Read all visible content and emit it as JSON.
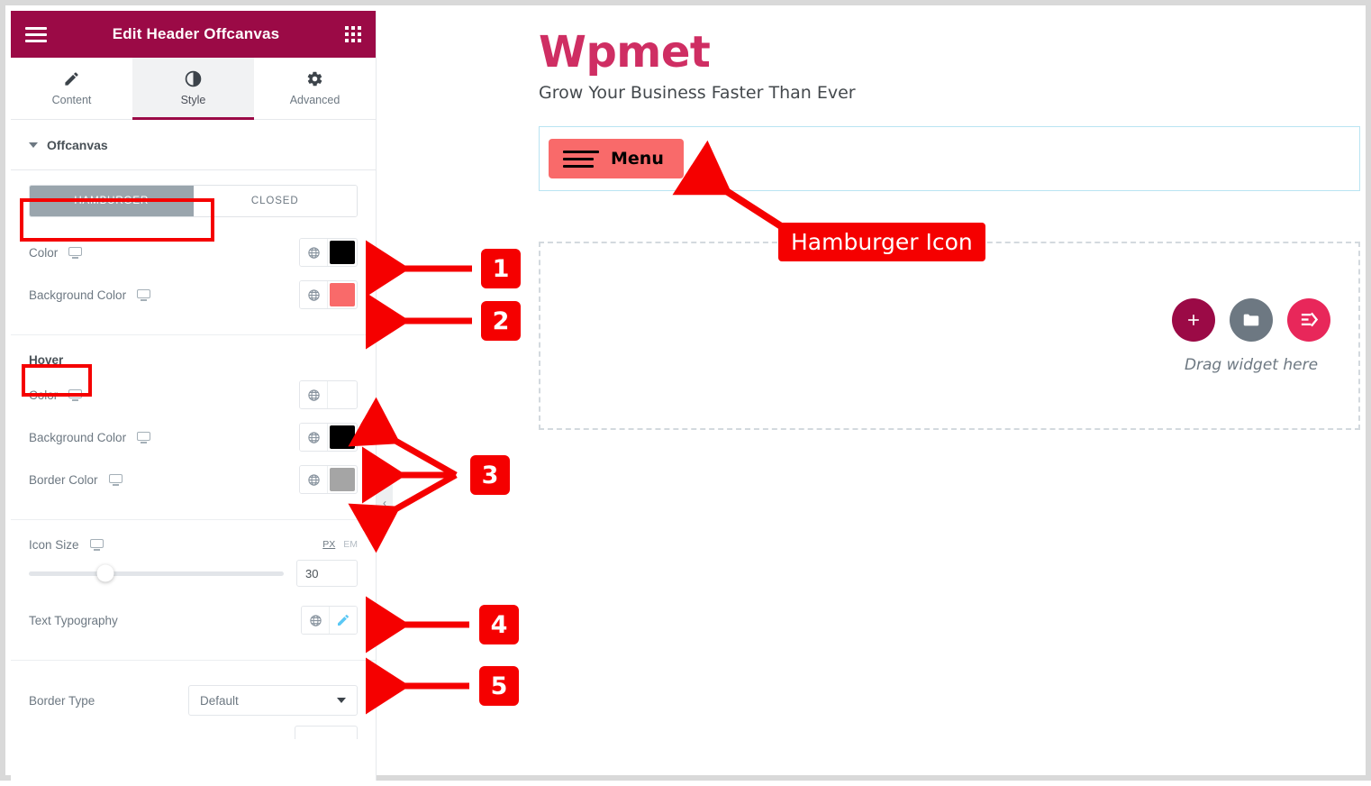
{
  "panel": {
    "header": {
      "title": "Edit Header Offcanvas",
      "menu_icon": "hamburger-icon",
      "grid_icon": "apps-grid-icon"
    },
    "tabs": [
      {
        "label": "Content",
        "icon": "pencil-icon",
        "active": false
      },
      {
        "label": "Style",
        "icon": "contrast-icon",
        "active": true
      },
      {
        "label": "Advanced",
        "icon": "gear-icon",
        "active": false
      }
    ],
    "section": {
      "title": "Offcanvas",
      "expanded": true
    },
    "state_toggle": {
      "options": [
        "HAMBURGER",
        "CLOSED"
      ],
      "selected": "HAMBURGER"
    },
    "normal_controls": [
      {
        "label": "Color",
        "value_color": "#000000",
        "responsive_icon": "monitor-icon",
        "globe_icon": "globe-icon"
      },
      {
        "label": "Background Color",
        "value_color": "#f96a6a",
        "responsive_icon": "monitor-icon",
        "globe_icon": "globe-icon"
      }
    ],
    "hover": {
      "title": "Hover",
      "controls": [
        {
          "label": "Color",
          "value_color": "#ffffff",
          "responsive_icon": "monitor-icon",
          "globe_icon": "globe-icon"
        },
        {
          "label": "Background Color",
          "value_color": "#000000",
          "responsive_icon": "monitor-icon",
          "globe_icon": "globe-icon"
        },
        {
          "label": "Border Color",
          "value_color": "#a5a5a5",
          "responsive_icon": "monitor-icon",
          "globe_icon": "globe-icon"
        }
      ]
    },
    "icon_size": {
      "label": "Icon Size",
      "responsive_icon": "monitor-icon",
      "units": [
        "PX",
        "EM"
      ],
      "active_unit": "PX",
      "value": "30",
      "slider_percent": 30
    },
    "text_typography": {
      "label": "Text Typography",
      "globe_icon": "globe-icon",
      "edit_icon": "pencil-edit-icon"
    },
    "border_type": {
      "label": "Border Type",
      "value": "Default",
      "chevron_icon": "chevron-down-icon"
    },
    "collapse_icon": "chevron-left-icon"
  },
  "canvas": {
    "site_title": "Wpmet",
    "site_tagline": "Grow Your Business Faster Than Ever",
    "menu_button": {
      "label": "Menu",
      "icon": "hamburger-icon",
      "background": "#f96a6a"
    },
    "dropzone": {
      "text": "Drag widget here",
      "buttons": [
        {
          "icon": "plus-icon",
          "color": "#9b0a46",
          "name": "add-section-button"
        },
        {
          "icon": "folder-icon",
          "color": "#6d7882",
          "name": "template-library-button"
        },
        {
          "icon": "elementskit-icon",
          "color": "#e8275a",
          "name": "elementskit-button"
        }
      ]
    }
  },
  "annotations": {
    "callout": "Hamburger Icon",
    "badges": [
      "1",
      "2",
      "3",
      "4",
      "5"
    ],
    "accent_color": "#f50000"
  }
}
